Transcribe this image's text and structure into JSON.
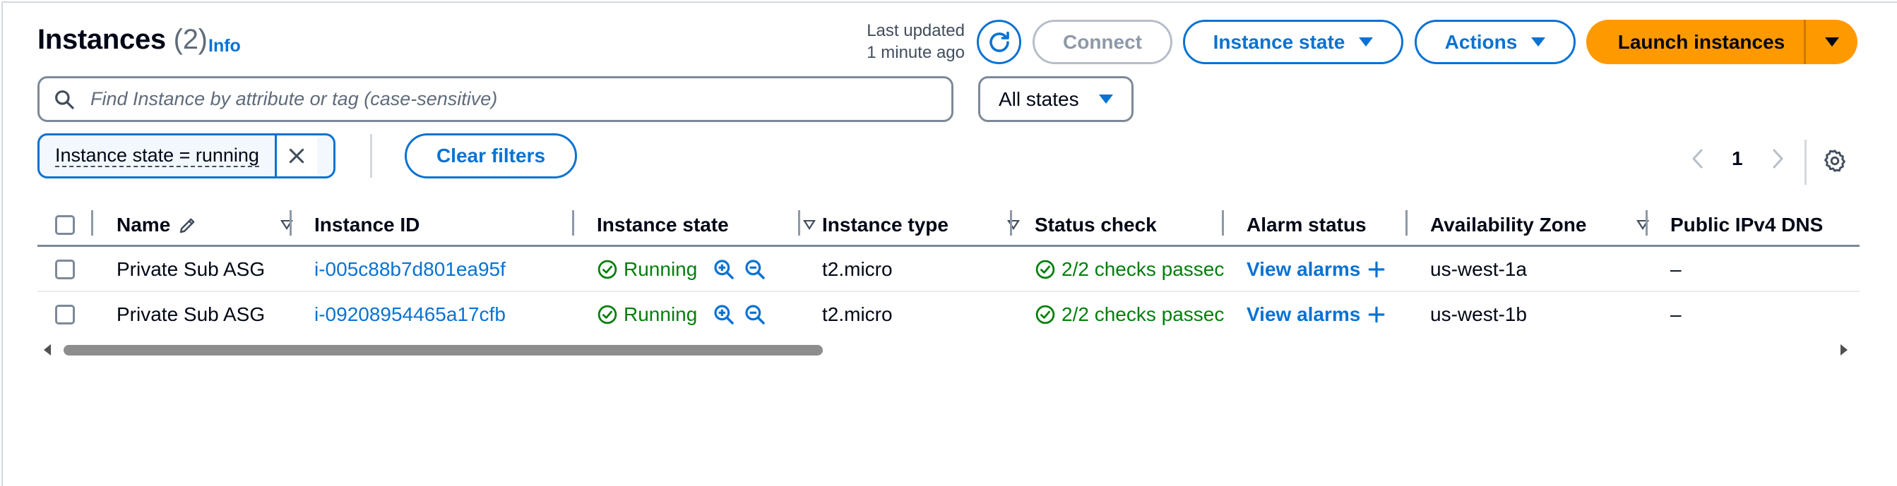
{
  "header": {
    "title": "Instances",
    "count": "(2)",
    "info_link": "Info",
    "last_updated_line1": "Last updated",
    "last_updated_line2": "1 minute ago"
  },
  "toolbar": {
    "refresh_icon": "refresh-icon",
    "connect_label": "Connect",
    "instance_state_label": "Instance state",
    "actions_label": "Actions",
    "launch_label": "Launch instances"
  },
  "search": {
    "placeholder": "Find Instance by attribute or tag (case-sensitive)",
    "value": ""
  },
  "state_filter": {
    "selected": "All states"
  },
  "filters": {
    "active_chip": "Instance state = running",
    "clear_label": "Clear filters"
  },
  "pagination": {
    "current_page": "1"
  },
  "table": {
    "columns": [
      "Name",
      "Instance ID",
      "Instance state",
      "Instance type",
      "Status check",
      "Alarm status",
      "Availability Zone",
      "Public IPv4 DNS"
    ],
    "rows": [
      {
        "name": "Private Sub ASG",
        "instance_id": "i-005c88b7d801ea95f",
        "state": "Running",
        "type": "t2.micro",
        "status_check": "2/2 checks passec",
        "alarm": "View alarms",
        "az": "us-west-1a",
        "dns": "–"
      },
      {
        "name": "Private Sub ASG",
        "instance_id": "i-09208954465a17cfb",
        "state": "Running",
        "type": "t2.micro",
        "status_check": "2/2 checks passec",
        "alarm": "View alarms",
        "az": "us-west-1b",
        "dns": "–"
      }
    ]
  },
  "colors": {
    "link_blue": "#0972d3",
    "launch_orange": "#ff9900",
    "success_green": "#037f0c",
    "border_grey": "#7d8998"
  }
}
